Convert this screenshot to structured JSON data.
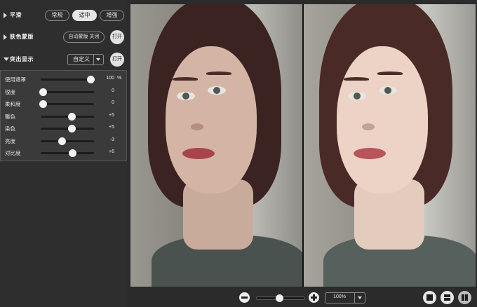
{
  "sections": {
    "smoothing": {
      "title": "平滑",
      "options": [
        "常规",
        "适中",
        "增强"
      ],
      "selected": "适中"
    },
    "skin_mask": {
      "title": "肤色蒙版",
      "toggle_label": "自动蒙版 关闭",
      "open_label": "打开"
    },
    "highlight": {
      "title": "突出显示",
      "preset": "自定义",
      "open_label": "打开",
      "sliders": [
        {
          "label": "使用遮罩",
          "value": "100",
          "unit": "%",
          "level": 1.0
        },
        {
          "label": "锐度",
          "value": "0",
          "unit": "",
          "level": 0.0
        },
        {
          "label": "柔和度",
          "value": "0",
          "unit": "",
          "level": 0.0
        },
        {
          "label": "暖色",
          "value": "+5",
          "unit": "",
          "level": 0.6
        },
        {
          "label": "染色",
          "value": "+5",
          "unit": "",
          "level": 0.6
        },
        {
          "label": "亮度",
          "value": "-3",
          "unit": "",
          "level": 0.4
        },
        {
          "label": "对比度",
          "value": "+6",
          "unit": "",
          "level": 0.62
        }
      ]
    }
  },
  "toolbar": {
    "zoom_value": "100%",
    "zoom_level": 0.5,
    "zoom_out_icon": "minus-circle-icon",
    "zoom_in_icon": "plus-circle-icon",
    "view_modes": [
      "single-view-icon",
      "split-horizontal-icon",
      "split-vertical-icon"
    ],
    "active_view": "split-vertical-icon"
  },
  "colors": {
    "panel_bg": "#2e2e2e",
    "sub_panel_bg": "#3a3a3a",
    "selected_pill": "#e6e6e6",
    "slider_thumb": "#f4f4f4"
  }
}
